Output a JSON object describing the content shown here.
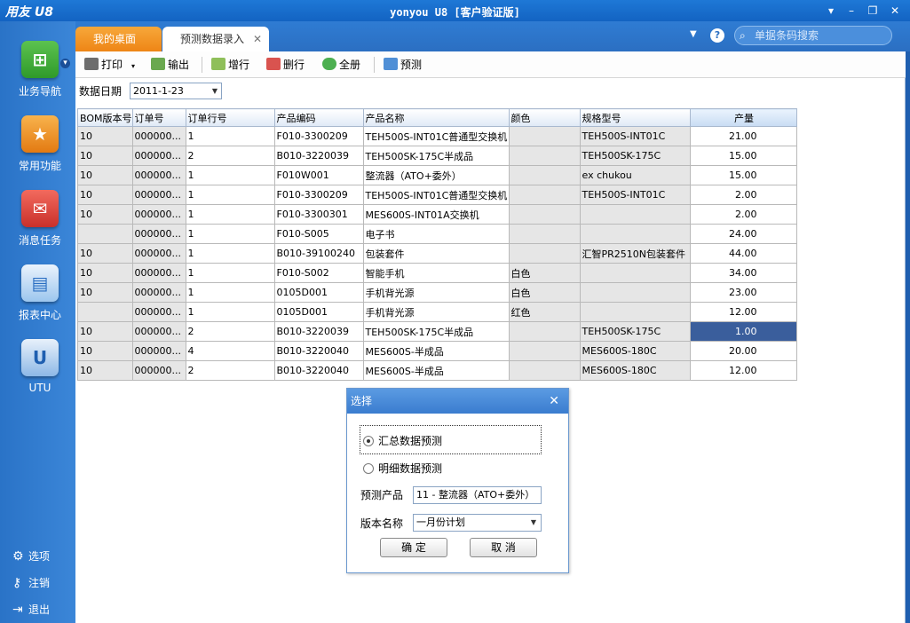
{
  "window": {
    "logo": "用友 U8",
    "title": "yonyou U8 [客户验证版]",
    "minimize_icon": "window-minimize-icon",
    "maximize_icon": "window-restore-icon",
    "close_icon": "window-close-icon"
  },
  "sidebar": {
    "items": [
      {
        "label": "业务导航",
        "icon": "business-nav-icon",
        "color": "#3aa83a"
      },
      {
        "label": "常用功能",
        "icon": "star-icon",
        "color": "#f08a1c"
      },
      {
        "label": "消息任务",
        "icon": "message-icon",
        "color": "#e0453b"
      },
      {
        "label": "报表中心",
        "icon": "report-icon",
        "color": "#5aa0e0"
      },
      {
        "label": "UTU",
        "icon": "utu-icon",
        "color": "#3a7ccf"
      }
    ],
    "bottom": [
      {
        "label": "选项",
        "icon": "gear-icon"
      },
      {
        "label": "注销",
        "icon": "key-icon"
      },
      {
        "label": "退出",
        "icon": "exit-icon"
      }
    ]
  },
  "tabs": [
    {
      "label": "我的桌面"
    },
    {
      "label": "预测数据录入"
    }
  ],
  "search": {
    "placeholder": "单据条码搜索"
  },
  "toolbar": {
    "print": "打印",
    "export": "输出",
    "add_row": "增行",
    "delete_row": "删行",
    "select_all": "全册",
    "forecast": "预测"
  },
  "filter": {
    "date_label": "数据日期",
    "date_value": "2011-1-23"
  },
  "grid": {
    "headers": [
      "BOM版本号",
      "订单号",
      "订单行号",
      "产品编码",
      "产品名称",
      "颜色",
      "规格型号",
      "产量"
    ],
    "rows": [
      [
        "10",
        "000000...",
        "1",
        "F010-3300209",
        "TEH500S-INT01C普通型交换机",
        "",
        "TEH500S-INT01C",
        "21.00"
      ],
      [
        "10",
        "000000...",
        "2",
        "B010-3220039",
        "TEH500SK-175C半成品",
        "",
        "TEH500SK-175C",
        "15.00"
      ],
      [
        "10",
        "000000...",
        "1",
        "F010W001",
        "整流器（ATO+委外）",
        "",
        "ex chukou",
        "15.00"
      ],
      [
        "10",
        "000000...",
        "1",
        "F010-3300209",
        "TEH500S-INT01C普通型交换机",
        "",
        "TEH500S-INT01C",
        "2.00"
      ],
      [
        "10",
        "000000...",
        "1",
        "F010-3300301",
        "MES600S-INT01A交换机",
        "",
        "",
        "2.00"
      ],
      [
        "",
        "000000...",
        "1",
        "F010-S005",
        "电子书",
        "",
        "",
        "24.00"
      ],
      [
        "10",
        "000000...",
        "1",
        "B010-39100240",
        "包装套件",
        "",
        "汇智PR2510N包装套件",
        "44.00"
      ],
      [
        "10",
        "000000...",
        "1",
        "F010-S002",
        "智能手机",
        "白色",
        "",
        "34.00"
      ],
      [
        "10",
        "000000...",
        "1",
        "0105D001",
        "手机背光源",
        "白色",
        "",
        "23.00"
      ],
      [
        "",
        "000000...",
        "1",
        "0105D001",
        "手机背光源",
        "红色",
        "",
        "12.00"
      ],
      [
        "10",
        "000000...",
        "2",
        "B010-3220039",
        "TEH500SK-175C半成品",
        "",
        "TEH500SK-175C",
        "1.00"
      ],
      [
        "10",
        "000000...",
        "4",
        "B010-3220040",
        "MES600S-半成品",
        "",
        "MES600S-180C",
        "20.00"
      ],
      [
        "10",
        "000000...",
        "2",
        "B010-3220040",
        "MES600S-半成品",
        "",
        "MES600S-180C",
        "12.00"
      ]
    ],
    "selected_row": 10
  },
  "dialog": {
    "title": "选择",
    "option_summary": "汇总数据预测",
    "option_detail": "明细数据预测",
    "selected_option": "汇总数据预测",
    "product_label": "预测产品",
    "product_value": "11 - 整流器（ATO+委外）",
    "version_label": "版本名称",
    "version_value": "一月份计划",
    "ok": "确 定",
    "cancel": "取 消"
  }
}
